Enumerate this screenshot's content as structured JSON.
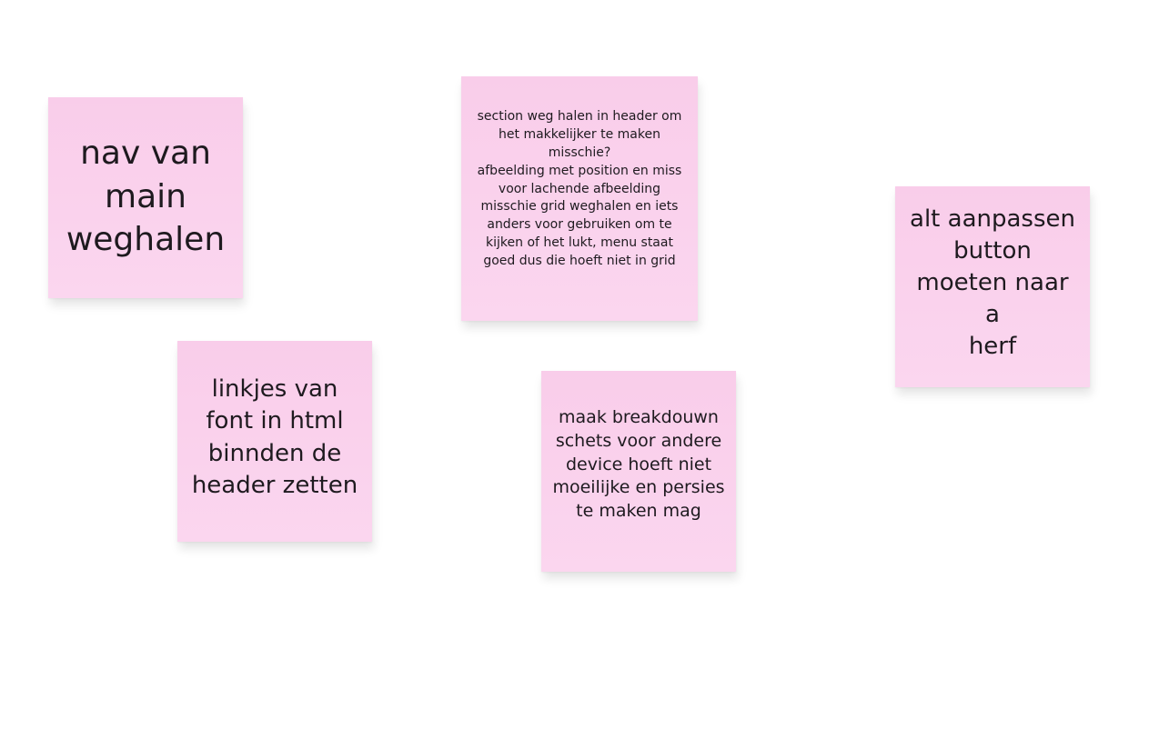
{
  "board": {
    "background": "#ffffff",
    "note_color": "#fbd3ee",
    "notes": [
      {
        "id": "note-1",
        "text": "nav van\nmain\nweghalen"
      },
      {
        "id": "note-2",
        "text": "section weg halen in header om\nhet makkelijker te maken\nmisschie?\nafbeelding met position en miss\nvoor lachende afbeelding\nmisschie grid weghalen en iets\nanders voor gebruiken om te\nkijken of het lukt, menu staat\ngoed dus die hoeft niet in grid"
      },
      {
        "id": "note-3",
        "text": "alt aanpassen\nbutton\nmoeten naar a\nherf"
      },
      {
        "id": "note-4",
        "text": "linkjes van\nfont in html\nbinnden de\nheader zetten"
      },
      {
        "id": "note-5",
        "text": "maak breakdouwn\nschets voor andere\ndevice hoeft niet\nmoeilijke en persies\nte maken mag"
      }
    ]
  }
}
